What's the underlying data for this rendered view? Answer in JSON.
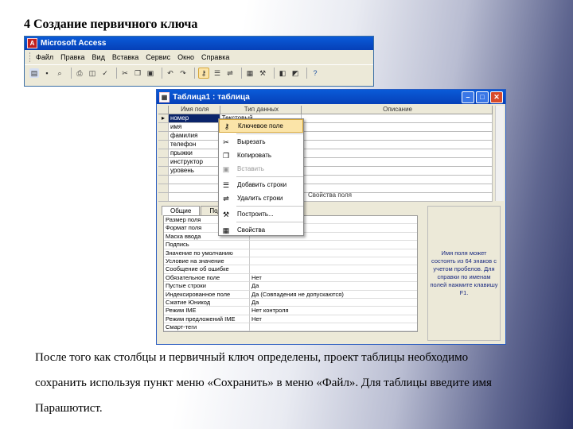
{
  "slide": {
    "title": "4 Создание первичного ключа",
    "caption_lines": [
      "После того как столбцы и первичный ключ определены, проект таблицы необходимо",
      "сохранить используя пункт меню «Сохранить» в меню «Файл». Для таблицы введите имя",
      "Парашютист."
    ]
  },
  "access": {
    "title": "Microsoft Access",
    "menu": [
      "Файл",
      "Правка",
      "Вид",
      "Вставка",
      "Сервис",
      "Окно",
      "Справка"
    ]
  },
  "table_window": {
    "title": "Таблица1 : таблица",
    "columns": [
      "Имя поля",
      "Тип данных",
      "Описание"
    ],
    "rows": [
      {
        "name": "номер",
        "type": "Текстовый"
      },
      {
        "name": "имя",
        "type": ""
      },
      {
        "name": "фамилия",
        "type": ""
      },
      {
        "name": "телефон",
        "type": ""
      },
      {
        "name": "прыжки",
        "type": ""
      },
      {
        "name": "инструктор",
        "type": ""
      },
      {
        "name": "уровень",
        "type": ""
      }
    ],
    "properties_label": "Свойства поля",
    "tabs": [
      "Общие",
      "Подстановка"
    ],
    "properties": [
      {
        "key": "Размер поля",
        "value": ""
      },
      {
        "key": "Формат поля",
        "value": ""
      },
      {
        "key": "Маска ввода",
        "value": ""
      },
      {
        "key": "Подпись",
        "value": ""
      },
      {
        "key": "Значение по умолчанию",
        "value": ""
      },
      {
        "key": "Условие на значение",
        "value": ""
      },
      {
        "key": "Сообщение об ошибке",
        "value": ""
      },
      {
        "key": "Обязательное поле",
        "value": "Нет"
      },
      {
        "key": "Пустые строки",
        "value": "Да"
      },
      {
        "key": "Индексированное поле",
        "value": "Да (Совпадения не допускаются)"
      },
      {
        "key": "Сжатие Юникод",
        "value": "Да"
      },
      {
        "key": "Режим IME",
        "value": "Нет контроля"
      },
      {
        "key": "Режим предложений IME",
        "value": "Нет"
      },
      {
        "key": "Смарт-теги",
        "value": ""
      }
    ],
    "hint": "Имя поля может состоять из 64 знаков с учетом пробелов. Для справки по именам полей нажмите клавишу F1."
  },
  "context_menu": {
    "items": [
      {
        "label": "Ключевое поле",
        "icon": "key-icon",
        "highlight": true,
        "disabled": false
      },
      {
        "label": "Вырезать",
        "icon": "scissors-icon",
        "highlight": false,
        "disabled": false
      },
      {
        "label": "Копировать",
        "icon": "copy-icon",
        "highlight": false,
        "disabled": false
      },
      {
        "label": "Вставить",
        "icon": "paste-icon",
        "highlight": false,
        "disabled": true
      },
      {
        "label": "Добавить строки",
        "icon": "insert-rows-icon",
        "highlight": false,
        "disabled": false
      },
      {
        "label": "Удалить строки",
        "icon": "delete-rows-icon",
        "highlight": false,
        "disabled": false
      },
      {
        "label": "Построить...",
        "icon": "build-icon",
        "highlight": false,
        "disabled": false
      },
      {
        "label": "Свойства",
        "icon": "properties-icon",
        "highlight": false,
        "disabled": false
      }
    ]
  }
}
